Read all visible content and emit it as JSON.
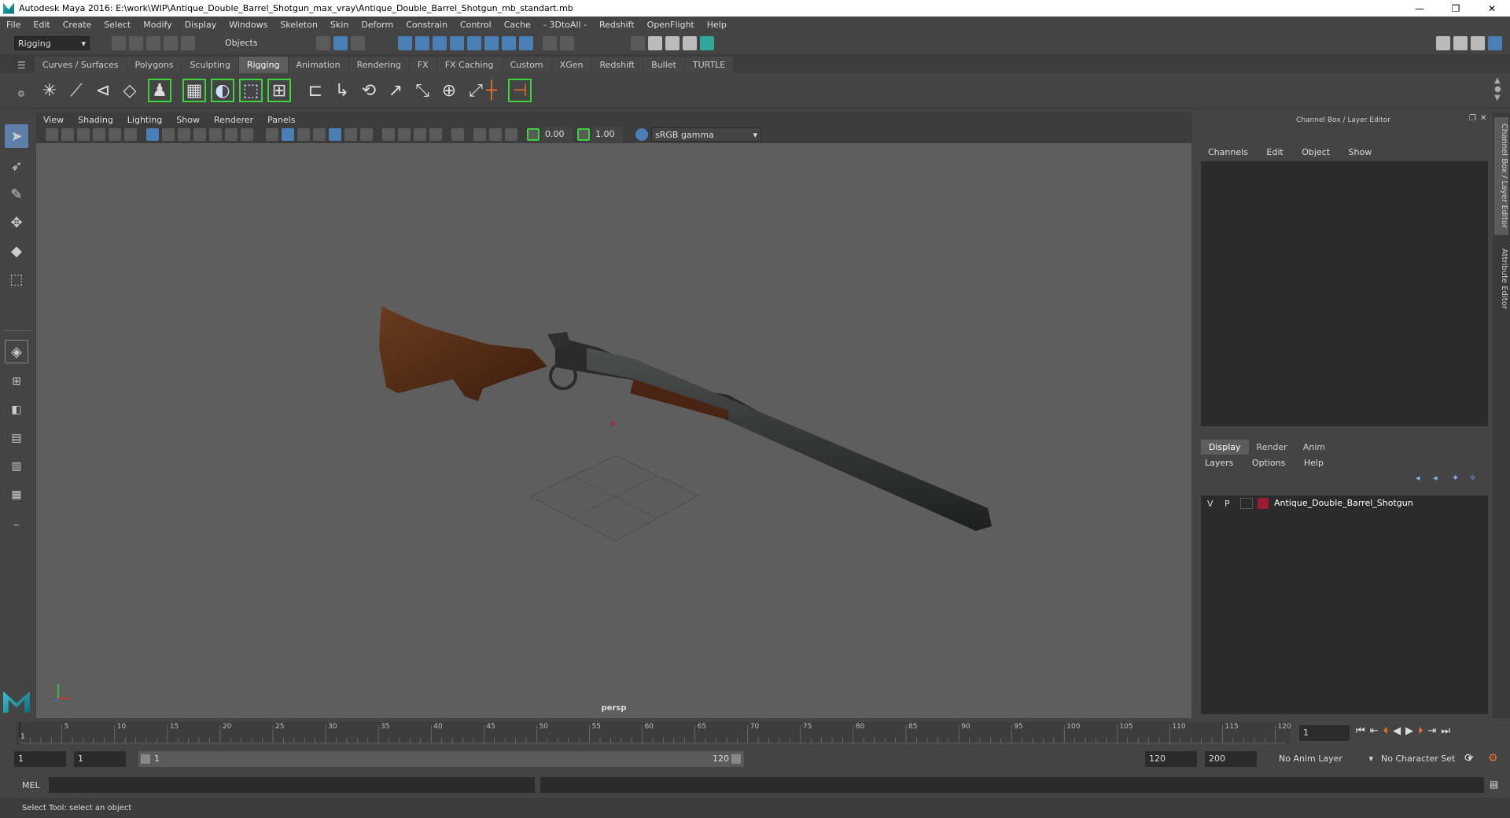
{
  "titlebar": {
    "title": "Autodesk Maya 2016: E:\\work\\WIP\\Antique_Double_Barrel_Shotgun_max_vray\\Antique_Double_Barrel_Shotgun_mb_standart.mb",
    "minimize": "—",
    "restore": "❐",
    "close": "✕"
  },
  "menubar": [
    "File",
    "Edit",
    "Create",
    "Select",
    "Modify",
    "Display",
    "Windows",
    "Skeleton",
    "Skin",
    "Deform",
    "Constrain",
    "Control",
    "Cache",
    "- 3DtoAll -",
    "Redshift",
    "OpenFlight",
    "Help"
  ],
  "statusline": {
    "mode": "Rigging",
    "objects_label": "Objects"
  },
  "shelf_tabs": [
    {
      "label": "Curves / Surfaces",
      "active": false
    },
    {
      "label": "Polygons",
      "active": false
    },
    {
      "label": "Sculpting",
      "active": false
    },
    {
      "label": "Rigging",
      "active": true
    },
    {
      "label": "Animation",
      "active": false
    },
    {
      "label": "Rendering",
      "active": false
    },
    {
      "label": "FX",
      "active": false
    },
    {
      "label": "FX Caching",
      "active": false
    },
    {
      "label": "Custom",
      "active": false
    },
    {
      "label": "XGen",
      "active": false
    },
    {
      "label": "Redshift",
      "active": false
    },
    {
      "label": "Bullet",
      "active": false
    },
    {
      "label": "TURTLE",
      "active": false
    }
  ],
  "viewport": {
    "menu": [
      "View",
      "Shading",
      "Lighting",
      "Show",
      "Renderer",
      "Panels"
    ],
    "exposure": "0.00",
    "gamma": "1.00",
    "color_space": "sRGB gamma",
    "camera_label": "persp"
  },
  "channelbox": {
    "title": "Channel Box / Layer Editor",
    "menu": [
      "Channels",
      "Edit",
      "Object",
      "Show"
    ],
    "layer_tabs": [
      {
        "label": "Display",
        "active": true
      },
      {
        "label": "Render",
        "active": false
      },
      {
        "label": "Anim",
        "active": false
      }
    ],
    "layer_menu": [
      "Layers",
      "Options",
      "Help"
    ],
    "layers": [
      {
        "v": "V",
        "p": "P",
        "color": "#9b1b30",
        "name": "Antique_Double_Barrel_Shotgun"
      }
    ],
    "side_tabs": [
      "Channel Box / Layer Editor",
      "Attribute Editor"
    ]
  },
  "timeline": {
    "ticks": [
      "5",
      "10",
      "15",
      "20",
      "25",
      "30",
      "35",
      "40",
      "45",
      "50",
      "55",
      "60",
      "65",
      "70",
      "75",
      "80",
      "85",
      "90",
      "95",
      "100",
      "105",
      "110",
      "115",
      "120"
    ],
    "start_tick": "1",
    "current_frame": "1"
  },
  "range": {
    "start": "1",
    "playback_start": "1",
    "slider_start": "1",
    "slider_end": "120",
    "playback_end": "120",
    "end": "200",
    "anim_layer": "No Anim Layer",
    "character_set": "No Character Set"
  },
  "cmdline": {
    "label": "MEL"
  },
  "helpline": {
    "text": "Select Tool: select an object"
  }
}
